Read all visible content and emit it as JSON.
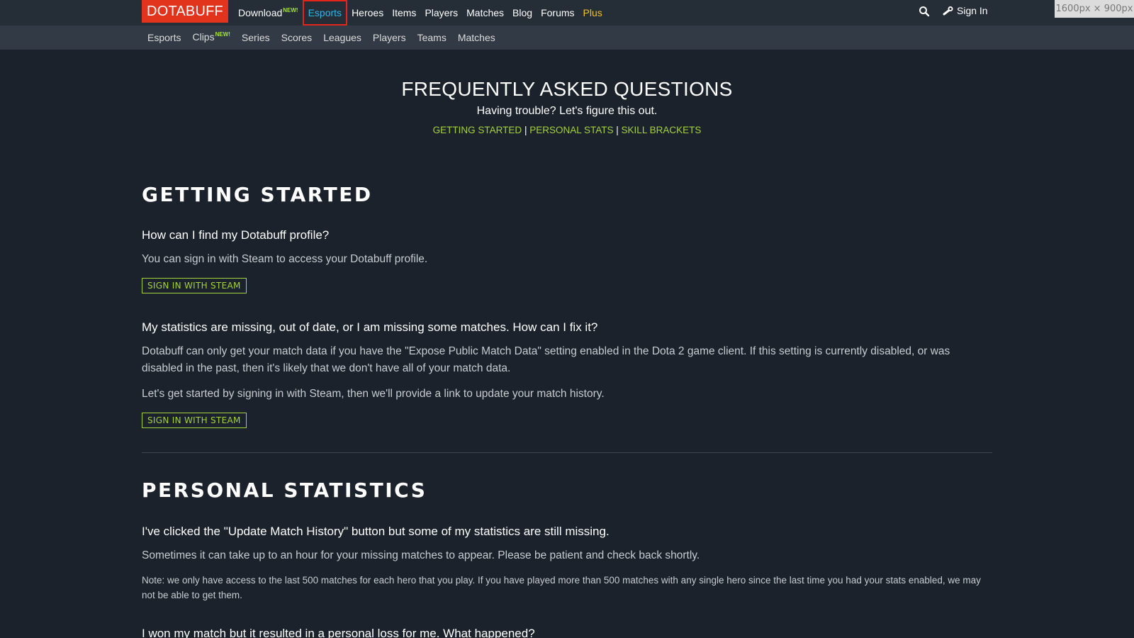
{
  "header": {
    "logo": "DOTABUFF",
    "nav": [
      {
        "label": "Download",
        "badge": "NEW!"
      },
      {
        "label": "Esports",
        "active": true
      },
      {
        "label": "Heroes"
      },
      {
        "label": "Items"
      },
      {
        "label": "Players"
      },
      {
        "label": "Matches"
      },
      {
        "label": "Blog"
      },
      {
        "label": "Forums"
      },
      {
        "label": "Plus"
      }
    ],
    "sign_in": "Sign In",
    "size_tag": "1600px × 900px"
  },
  "subnav": [
    {
      "label": "Esports"
    },
    {
      "label": "Clips",
      "badge": "NEW!"
    },
    {
      "label": "Series"
    },
    {
      "label": "Scores"
    },
    {
      "label": "Leagues"
    },
    {
      "label": "Players"
    },
    {
      "label": "Teams"
    },
    {
      "label": "Matches"
    }
  ],
  "hero": {
    "title": "FREQUENTLY ASKED QUESTIONS",
    "subtitle": "Having trouble? Let's figure this out.",
    "links": [
      "GETTING STARTED",
      "PERSONAL STATS",
      "SKILL BRACKETS"
    ],
    "separator": "|"
  },
  "sections": {
    "getting_started": {
      "title": "GETTING STARTED",
      "q1": "How can I find my Dotabuff profile?",
      "a1": "You can sign in with Steam to access your Dotabuff profile.",
      "button1": "SIGN IN WITH STEAM",
      "q2": "My statistics are missing, out of date, or I am missing some matches. How can I fix it?",
      "a2": "Dotabuff can only get your match data if you have the \"Expose Public Match Data\" setting enabled in the Dota 2 game client. If this setting is currently disabled, or was disabled in the past, then it's likely that we don't have all of your match data.",
      "a2b": "Let's get started by signing in with Steam, then we'll provide a link to update your match history.",
      "button2": "SIGN IN WITH STEAM"
    },
    "personal_statistics": {
      "title": "PERSONAL STATISTICS",
      "q1": "I've clicked the \"Update Match History\" button but some of my statistics are still missing.",
      "a1": "Sometimes it can take up to an hour for your missing matches to appear. Please be patient and check back shortly.",
      "note": "Note: we only have access to the last 500 matches for each hero that you play. If you have played more than 500 matches with any single hero since the last time you had your stats enabled, we may not be able to get them.",
      "q2": "I won my match but it resulted in a personal loss for me. What happened?"
    }
  },
  "colors": {
    "background": "#1b222b",
    "logo": "#e2341d",
    "accent_green": "#a3d23a",
    "active_blue": "#2fb7e8",
    "plus_gold": "#f0c22d"
  }
}
